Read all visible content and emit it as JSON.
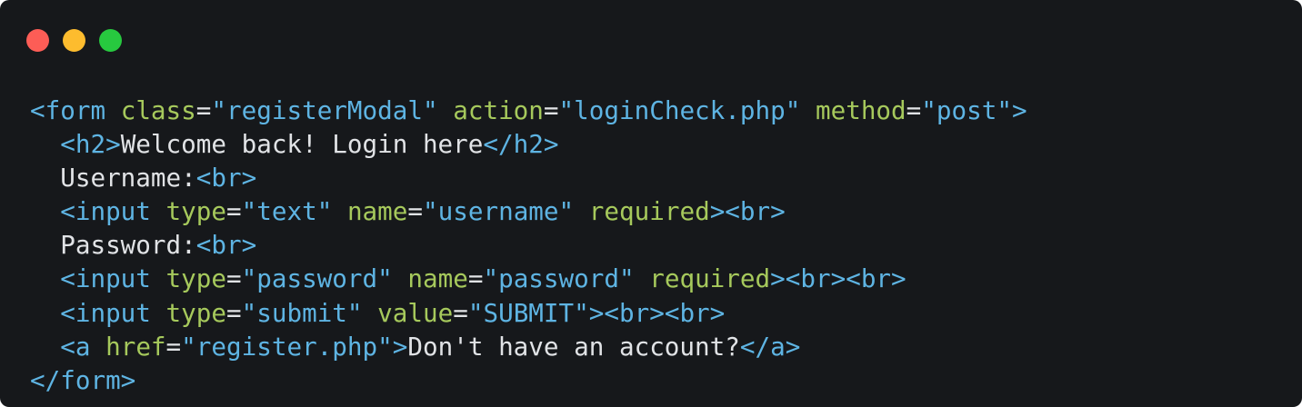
{
  "window": {
    "controls": [
      {
        "name": "close",
        "color": "#fd5d56"
      },
      {
        "name": "minimize",
        "color": "#fdbc2e"
      },
      {
        "name": "maximize",
        "color": "#27c93f"
      }
    ]
  },
  "colors": {
    "background": "#16181b",
    "tag": "#5eb4e3",
    "attribute": "#a6c95c",
    "string": "#5eb4e3",
    "text": "#e1e3e6"
  },
  "code": {
    "lines": [
      [
        {
          "t": "tag",
          "v": "<form"
        },
        {
          "t": "punct",
          "v": " "
        },
        {
          "t": "attr",
          "v": "class"
        },
        {
          "t": "punct",
          "v": "="
        },
        {
          "t": "str",
          "v": "\"registerModal\""
        },
        {
          "t": "punct",
          "v": " "
        },
        {
          "t": "attr",
          "v": "action"
        },
        {
          "t": "punct",
          "v": "="
        },
        {
          "t": "str",
          "v": "\"loginCheck.php\""
        },
        {
          "t": "punct",
          "v": " "
        },
        {
          "t": "attr",
          "v": "method"
        },
        {
          "t": "punct",
          "v": "="
        },
        {
          "t": "str",
          "v": "\"post\""
        },
        {
          "t": "tag",
          "v": ">"
        }
      ],
      [
        {
          "t": "punct",
          "v": "  "
        },
        {
          "t": "tag",
          "v": "<h2>"
        },
        {
          "t": "text",
          "v": "Welcome back! Login here"
        },
        {
          "t": "tag",
          "v": "</h2>"
        }
      ],
      [
        {
          "t": "punct",
          "v": "  "
        },
        {
          "t": "text",
          "v": "Username:"
        },
        {
          "t": "tag",
          "v": "<br>"
        }
      ],
      [
        {
          "t": "punct",
          "v": "  "
        },
        {
          "t": "tag",
          "v": "<input"
        },
        {
          "t": "punct",
          "v": " "
        },
        {
          "t": "attr",
          "v": "type"
        },
        {
          "t": "punct",
          "v": "="
        },
        {
          "t": "str",
          "v": "\"text\""
        },
        {
          "t": "punct",
          "v": " "
        },
        {
          "t": "attr",
          "v": "name"
        },
        {
          "t": "punct",
          "v": "="
        },
        {
          "t": "str",
          "v": "\"username\""
        },
        {
          "t": "punct",
          "v": " "
        },
        {
          "t": "attr",
          "v": "required"
        },
        {
          "t": "tag",
          "v": "><br>"
        }
      ],
      [
        {
          "t": "punct",
          "v": "  "
        },
        {
          "t": "text",
          "v": "Password:"
        },
        {
          "t": "tag",
          "v": "<br>"
        }
      ],
      [
        {
          "t": "punct",
          "v": "  "
        },
        {
          "t": "tag",
          "v": "<input"
        },
        {
          "t": "punct",
          "v": " "
        },
        {
          "t": "attr",
          "v": "type"
        },
        {
          "t": "punct",
          "v": "="
        },
        {
          "t": "str",
          "v": "\"password\""
        },
        {
          "t": "punct",
          "v": " "
        },
        {
          "t": "attr",
          "v": "name"
        },
        {
          "t": "punct",
          "v": "="
        },
        {
          "t": "str",
          "v": "\"password\""
        },
        {
          "t": "punct",
          "v": " "
        },
        {
          "t": "attr",
          "v": "required"
        },
        {
          "t": "tag",
          "v": "><br><br>"
        }
      ],
      [
        {
          "t": "punct",
          "v": "  "
        },
        {
          "t": "tag",
          "v": "<input"
        },
        {
          "t": "punct",
          "v": " "
        },
        {
          "t": "attr",
          "v": "type"
        },
        {
          "t": "punct",
          "v": "="
        },
        {
          "t": "str",
          "v": "\"submit\""
        },
        {
          "t": "punct",
          "v": " "
        },
        {
          "t": "attr",
          "v": "value"
        },
        {
          "t": "punct",
          "v": "="
        },
        {
          "t": "str",
          "v": "\"SUBMIT\""
        },
        {
          "t": "tag",
          "v": "><br><br>"
        }
      ],
      [
        {
          "t": "punct",
          "v": "  "
        },
        {
          "t": "tag",
          "v": "<a"
        },
        {
          "t": "punct",
          "v": " "
        },
        {
          "t": "attr",
          "v": "href"
        },
        {
          "t": "punct",
          "v": "="
        },
        {
          "t": "str",
          "v": "\"register.php\""
        },
        {
          "t": "tag",
          "v": ">"
        },
        {
          "t": "text",
          "v": "Don't have an account?"
        },
        {
          "t": "tag",
          "v": "</a>"
        }
      ],
      [
        {
          "t": "tag",
          "v": "</form>"
        }
      ]
    ]
  }
}
